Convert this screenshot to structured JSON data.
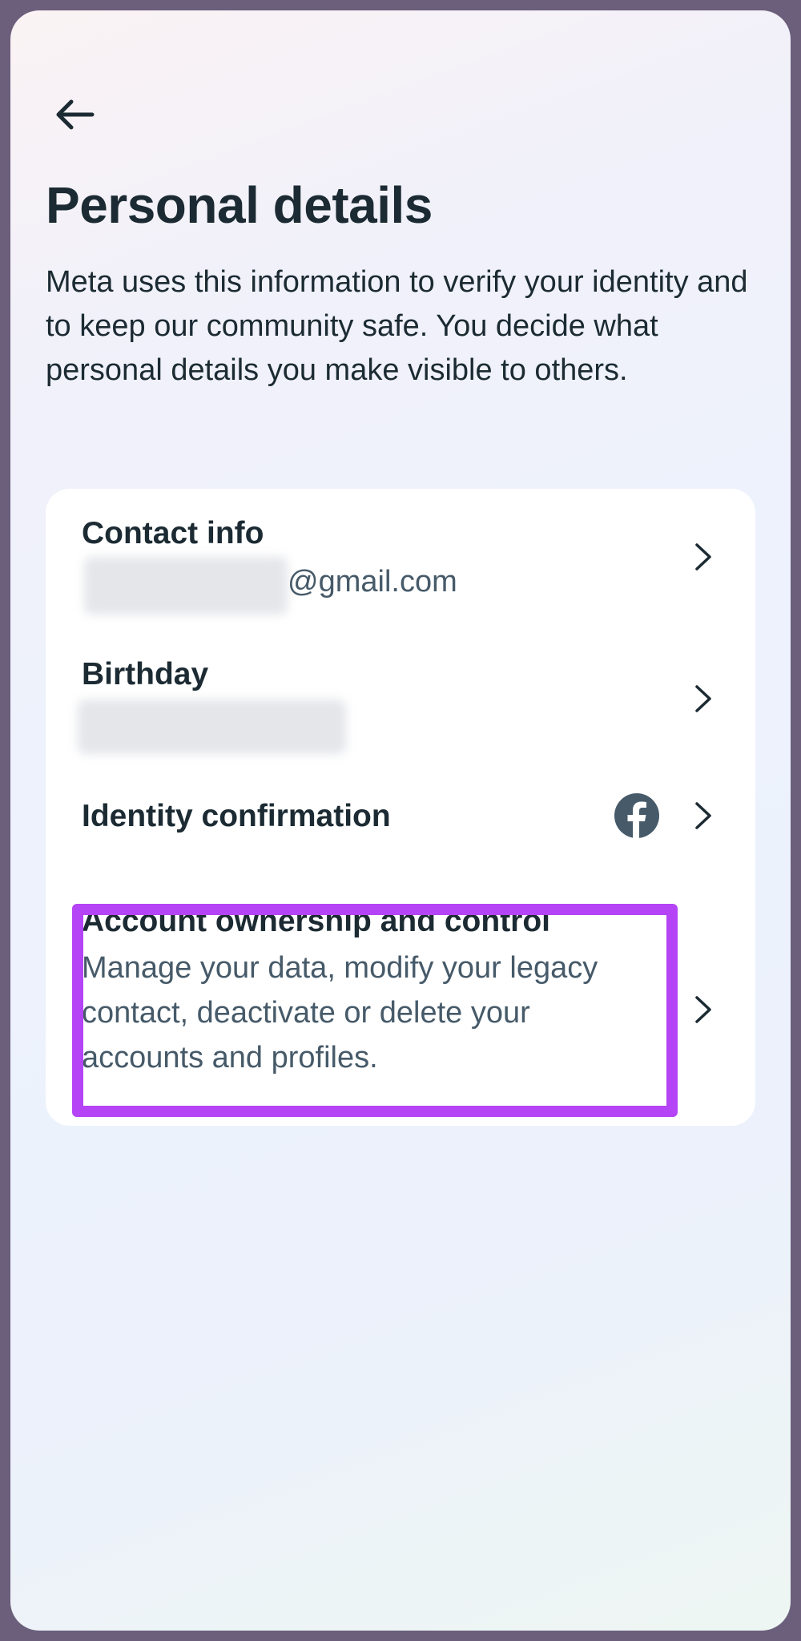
{
  "header": {
    "title": "Personal details",
    "description": "Meta uses this information to verify your identity and to keep our community safe. You decide what personal details you make visible to others."
  },
  "items": [
    {
      "title": "Contact info",
      "subtitle": "@gmail.com"
    },
    {
      "title": "Birthday"
    },
    {
      "title": "Identity confirmation"
    },
    {
      "title": "Account ownership and control",
      "description": "Manage your data, modify your legacy contact, deactivate or delete your accounts and profiles."
    }
  ],
  "colors": {
    "text_primary": "#1c2b33",
    "text_secondary": "#465a69",
    "highlight": "#b444f5"
  },
  "icons": {
    "back": "arrow-left-icon",
    "chevron": "chevron-right-icon",
    "facebook": "facebook-icon"
  }
}
